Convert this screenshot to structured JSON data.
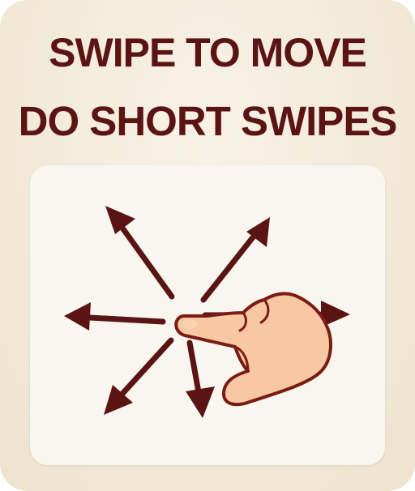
{
  "instructions": {
    "line1": "SWIPE TO MOVE",
    "line2": "DO SHORT SWIPES"
  },
  "colors": {
    "text": "#5b1414",
    "arrow": "#5b1414",
    "panel": "#f9f6ef",
    "card": "#f1e8d6",
    "hand_fill": "#f7c8a3",
    "hand_outline": "#7a1c14"
  },
  "icons": {
    "arrows": [
      "arrow-up-left-icon",
      "arrow-up-right-icon",
      "arrow-left-icon",
      "arrow-right-icon",
      "arrow-down-left-icon",
      "arrow-down-icon"
    ],
    "hand": "pointing-hand-icon"
  }
}
